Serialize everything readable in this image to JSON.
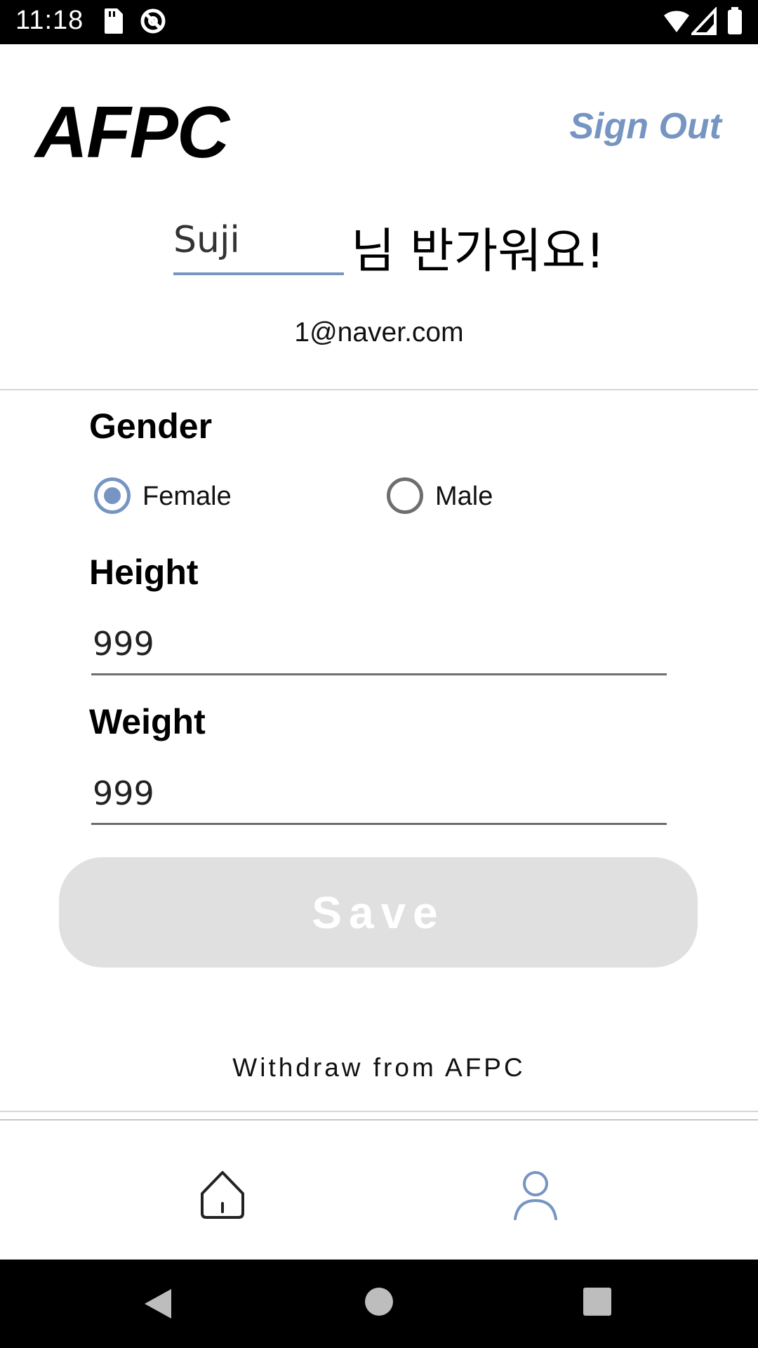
{
  "status_bar": {
    "time": "11:18",
    "left_icons": [
      "sd-card-icon",
      "data-saver-icon"
    ],
    "right_icons": [
      "wifi-icon",
      "signal-icon",
      "battery-icon"
    ]
  },
  "header": {
    "app_title": "AFPC",
    "sign_out_label": "Sign Out"
  },
  "greeting": {
    "name_value": "Suji",
    "suffix_text": "님 반가워요!",
    "email": "1@naver.com"
  },
  "form": {
    "gender": {
      "label": "Gender",
      "options": [
        {
          "label": "Female",
          "selected": true
        },
        {
          "label": "Male",
          "selected": false
        }
      ]
    },
    "height": {
      "label": "Height",
      "value": "999"
    },
    "weight": {
      "label": "Weight",
      "value": "999"
    },
    "save_label": "Save"
  },
  "withdraw_label": "Withdraw from AFPC",
  "tab_bar": {
    "tabs": [
      {
        "icon": "home-icon",
        "active": false
      },
      {
        "icon": "profile-icon",
        "active": true
      }
    ]
  },
  "nav_bar": {
    "buttons": [
      "back-icon",
      "home-circle-icon",
      "recents-icon"
    ]
  },
  "colors": {
    "accent": "#7695c2",
    "save_button_bg": "#e0e0e0",
    "status_bar_bg": "#000000"
  }
}
